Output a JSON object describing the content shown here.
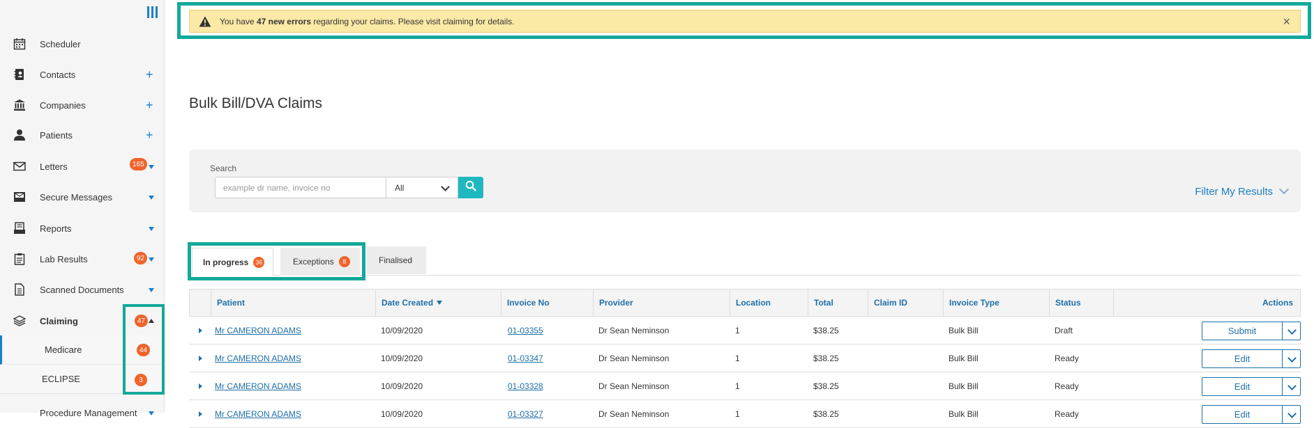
{
  "sidebar": {
    "items": [
      {
        "label": "Scheduler",
        "icon": "calendar-icon"
      },
      {
        "label": "Contacts",
        "icon": "contacts-icon",
        "action": "+"
      },
      {
        "label": "Companies",
        "icon": "bank-icon",
        "action": "+"
      },
      {
        "label": "Patients",
        "icon": "person-icon",
        "action": "+"
      },
      {
        "label": "Letters",
        "icon": "envelope-icon",
        "badge": "165"
      },
      {
        "label": "Secure Messages",
        "icon": "inbox-icon"
      },
      {
        "label": "Reports",
        "icon": "reports-icon"
      },
      {
        "label": "Lab Results",
        "icon": "clipboard-icon",
        "badge": "92"
      },
      {
        "label": "Scanned Documents",
        "icon": "document-icon"
      },
      {
        "label": "Claiming",
        "icon": "layers-icon",
        "badge": "47"
      },
      {
        "label": "Procedure Management"
      }
    ],
    "subitems": [
      {
        "label": "Medicare",
        "badge": "44"
      },
      {
        "label": "ECLIPSE",
        "badge": "3"
      }
    ]
  },
  "alert": {
    "prefix": "You have ",
    "count_text": "47 new errors",
    "suffix": " regarding your claims. Please visit claiming for details.",
    "close": "×"
  },
  "page_title": "Bulk Bill/DVA Claims",
  "search": {
    "label": "Search",
    "placeholder": "example dr name, invoice no",
    "select_value": "All",
    "filter_label": "Filter My Results"
  },
  "tabs": [
    {
      "label": "In progress",
      "badge": "36"
    },
    {
      "label": "Exceptions",
      "badge": "8"
    },
    {
      "label": "Finalised"
    }
  ],
  "table": {
    "headers": [
      "Patient",
      "Date Created",
      "Invoice No",
      "Provider",
      "Location",
      "Total",
      "Claim ID",
      "Invoice Type",
      "Status",
      "Actions"
    ],
    "rows": [
      {
        "patient": "Mr CAMERON ADAMS",
        "date": "10/09/2020",
        "invoice": "01-03355",
        "provider": "Dr Sean Neminson",
        "location": "1",
        "total": "$38.25",
        "claim_id": "",
        "type": "Bulk Bill",
        "status": "Draft",
        "action": "Submit"
      },
      {
        "patient": "Mr CAMERON ADAMS",
        "date": "10/09/2020",
        "invoice": "01-03347",
        "provider": "Dr Sean Neminson",
        "location": "1",
        "total": "$38.25",
        "claim_id": "",
        "type": "Bulk Bill",
        "status": "Ready",
        "action": "Edit"
      },
      {
        "patient": "Mr CAMERON ADAMS",
        "date": "10/09/2020",
        "invoice": "01-03328",
        "provider": "Dr Sean Neminson",
        "location": "1",
        "total": "$38.25",
        "claim_id": "",
        "type": "Bulk Bill",
        "status": "Ready",
        "action": "Edit"
      },
      {
        "patient": "Mr CAMERON ADAMS",
        "date": "10/09/2020",
        "invoice": "01-03327",
        "provider": "Dr Sean Neminson",
        "location": "1",
        "total": "$38.25",
        "claim_id": "",
        "type": "Bulk Bill",
        "status": "Ready",
        "action": "Edit"
      }
    ]
  },
  "colors": {
    "accent": "#1d7fc4",
    "highlight": "#14a89a",
    "badge": "#f0642a",
    "alert_bg": "#fbe9a6",
    "search_btn": "#20b8c0"
  }
}
